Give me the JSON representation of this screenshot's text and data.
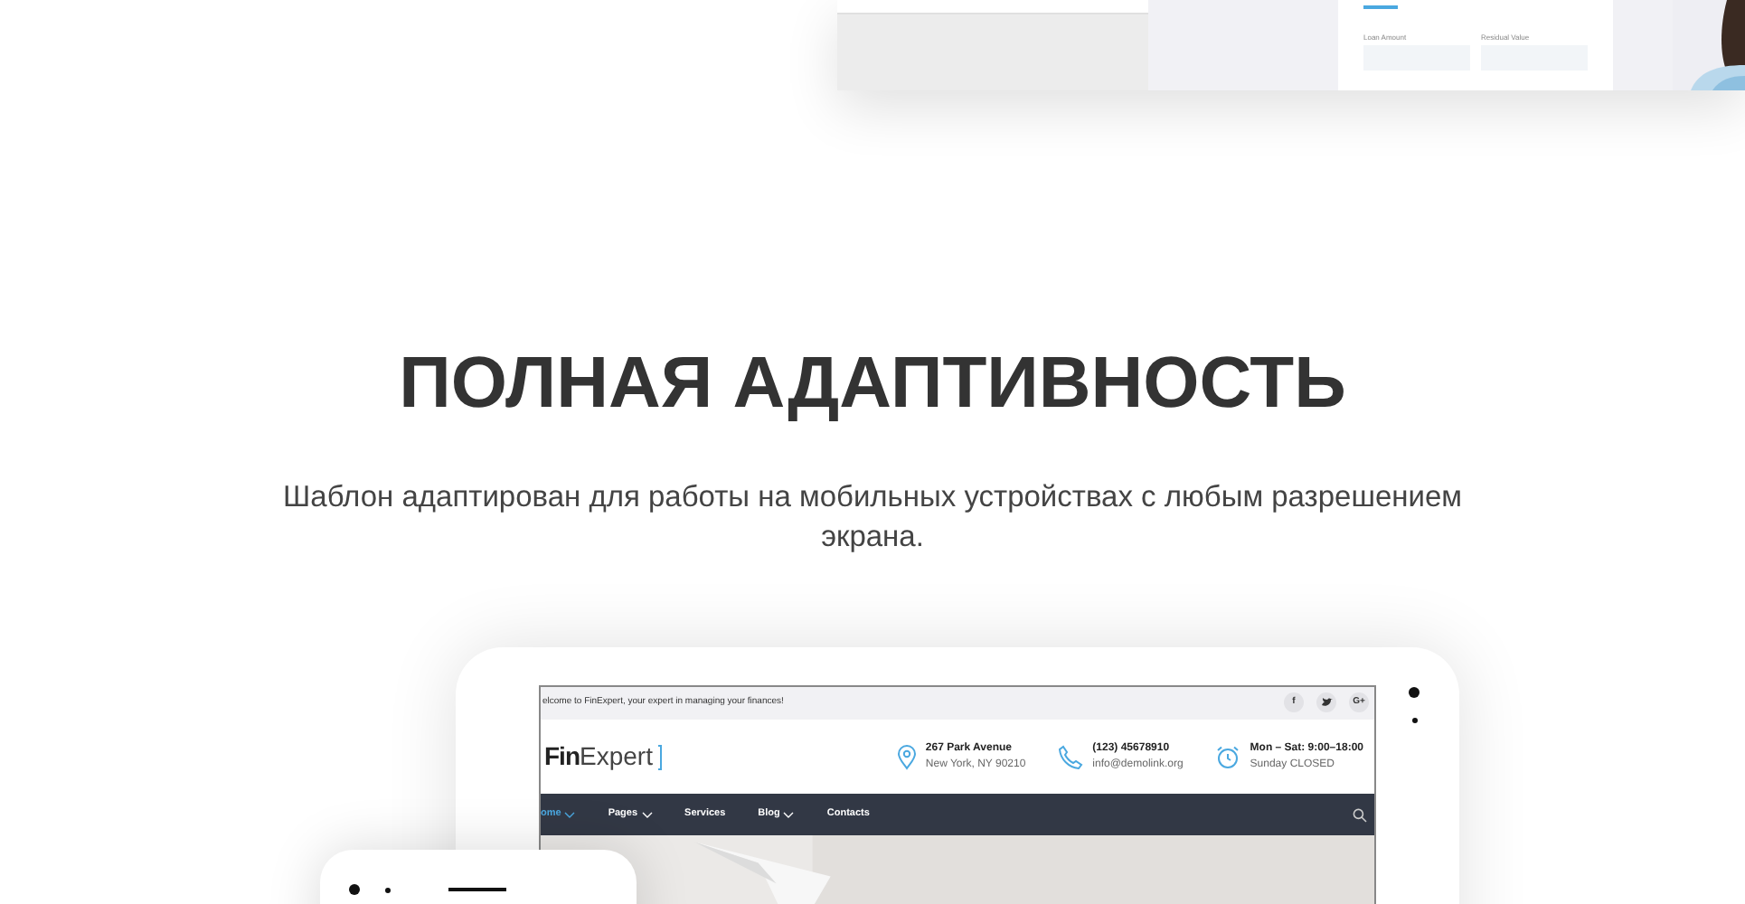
{
  "top_preview": {
    "fields": [
      {
        "label": "Loan Amount"
      },
      {
        "label": "Residual Value"
      }
    ]
  },
  "section": {
    "title": "ПОЛНАЯ АДАПТИВНОСТЬ",
    "description": "Шаблон адаптирован для работы на мобильных устройствах с любым разрешением экрана."
  },
  "tablet_site": {
    "welcome": "elcome to FinExpert, your expert in managing your finances!",
    "social": [
      {
        "kind": "text",
        "label": "f"
      },
      {
        "kind": "bird"
      },
      {
        "kind": "text",
        "label": "G+"
      }
    ],
    "logo": {
      "bold": "Fin",
      "light": "Expert"
    },
    "contacts": [
      {
        "kind": "pin",
        "line1": "267 Park Avenue",
        "line2": "New York, NY 90210"
      },
      {
        "kind": "phone",
        "line1": "(123) 45678910",
        "line2": "info@demolink.org"
      },
      {
        "kind": "clock",
        "line1": "Mon – Sat: 9:00–18:00",
        "line2": "Sunday CLOSED"
      }
    ],
    "nav": [
      {
        "label": "ome",
        "selected": true,
        "dropdown": true
      },
      {
        "label": "Pages",
        "selected": false,
        "dropdown": true
      },
      {
        "label": "Services",
        "selected": false,
        "dropdown": false
      },
      {
        "label": "Blog",
        "selected": false,
        "dropdown": true
      },
      {
        "label": "Contacts",
        "selected": false,
        "dropdown": false
      }
    ]
  }
}
